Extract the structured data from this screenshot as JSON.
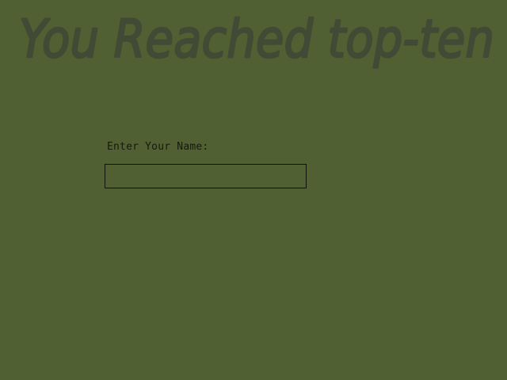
{
  "banner": {
    "title": "You Reached top-ten"
  },
  "name_entry": {
    "label": "Enter Your Name:",
    "value": ""
  },
  "colors": {
    "background": "#506032",
    "banner_ink": "#414a35",
    "text": "#151a0e"
  }
}
